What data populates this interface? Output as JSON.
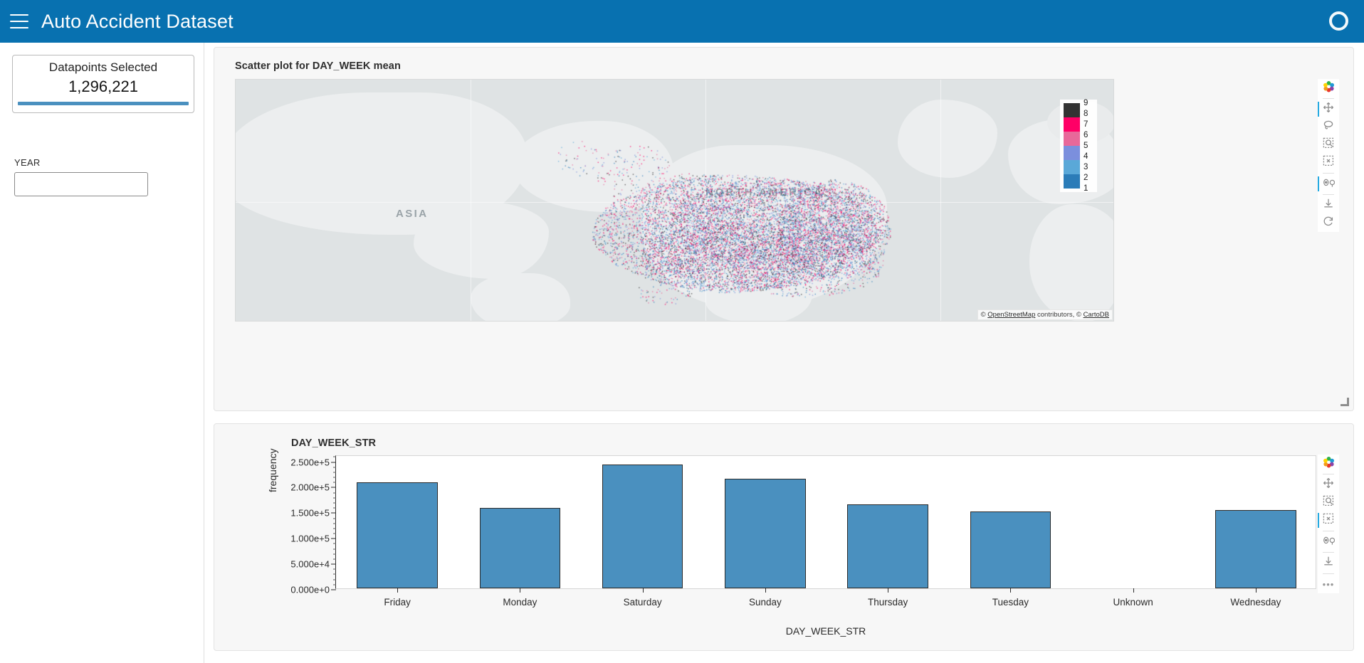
{
  "header": {
    "title": "Auto Accident Dataset",
    "menu_icon": "hamburger-menu-icon",
    "spinner_icon": "loading-circle-icon"
  },
  "sidebar": {
    "stat_card": {
      "title": "Datapoints Selected",
      "value": "1,296,221"
    },
    "filter": {
      "label": "YEAR",
      "value": "",
      "placeholder": ""
    }
  },
  "map_panel": {
    "title": "Scatter plot for DAY_WEEK mean",
    "continent_labels": [
      "ASIA",
      "NORTH AMERICA"
    ],
    "attribution_prefix": "© ",
    "attribution_osm": "OpenStreetMap",
    "attribution_mid": " contributors, © ",
    "attribution_carto": "CartoDB",
    "colorbar": {
      "ticks": [
        "9",
        "8",
        "7",
        "6",
        "5",
        "4",
        "3",
        "2",
        "1"
      ],
      "colors": [
        "#333333",
        "#ff0066",
        "#e8689a",
        "#7b8fdd",
        "#5aa8d8",
        "#2b7cb8"
      ]
    },
    "toolbar": [
      {
        "name": "bokeh-logo-icon",
        "active": false
      },
      {
        "name": "pan-tool-icon",
        "active": true
      },
      {
        "name": "lasso-select-tool-icon",
        "active": false
      },
      {
        "name": "box-zoom-tool-icon",
        "active": false
      },
      {
        "name": "box-select-tool-icon",
        "active": false
      },
      {
        "name": "hover-tool-icon",
        "active": true
      },
      {
        "name": "save-tool-icon",
        "active": false
      },
      {
        "name": "reset-tool-icon",
        "active": false
      }
    ]
  },
  "bar_panel": {
    "toolbar": [
      {
        "name": "bokeh-logo-icon",
        "active": false
      },
      {
        "name": "pan-tool-icon",
        "active": false
      },
      {
        "name": "box-zoom-tool-icon",
        "active": false
      },
      {
        "name": "box-select-tool-icon",
        "active": true
      },
      {
        "name": "hover-tool-icon",
        "active": false
      },
      {
        "name": "save-tool-icon",
        "active": false
      },
      {
        "name": "more-tools-icon",
        "active": false
      }
    ]
  },
  "chart_data": {
    "type": "bar",
    "title": "DAY_WEEK_STR",
    "xlabel": "DAY_WEEK_STR",
    "ylabel": "frequency",
    "categories": [
      "Friday",
      "Monday",
      "Saturday",
      "Sunday",
      "Thursday",
      "Tuesday",
      "Unknown",
      "Wednesday"
    ],
    "values": [
      208000,
      157000,
      243000,
      214000,
      164000,
      150000,
      0,
      153000
    ],
    "ylim": [
      0,
      262000
    ],
    "ytick_values": [
      0,
      50000,
      100000,
      150000,
      200000,
      250000
    ],
    "ytick_labels": [
      "0.000e+0",
      "5.000e+4",
      "1.000e+5",
      "1.500e+5",
      "2.000e+5",
      "2.500e+5"
    ],
    "bar_color": "#4a90bf",
    "bar_line_color": "#2b2b2b",
    "grid": false,
    "legend": "none"
  }
}
